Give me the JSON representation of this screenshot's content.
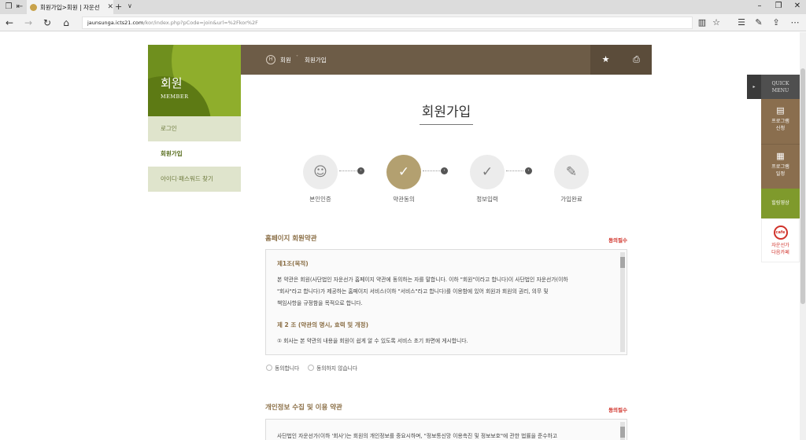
{
  "browser": {
    "tab_title": "회원가입>회원 | 자운선",
    "url_host": "jaunsunga.icts21.com",
    "url_path": "/kor/index.php?pCode=join&url=%2Fkor%2F"
  },
  "lnb": {
    "title": "회원",
    "subtitle": "MEMBER",
    "items": [
      {
        "label": "로그인",
        "active": false
      },
      {
        "label": "회원가입",
        "active": true
      },
      {
        "label": "아이디·패스워드 찾기",
        "active": false
      }
    ]
  },
  "breadcrumb": {
    "home": "H",
    "level1": "회원",
    "level2": "회원가입"
  },
  "page": {
    "title": "회원가입"
  },
  "steps": [
    {
      "label": "본인인증",
      "icon": "person-icon",
      "glyph": "☺",
      "active": false
    },
    {
      "label": "약관동의",
      "icon": "check-circle-icon",
      "glyph": "✓",
      "active": true
    },
    {
      "label": "정보입력",
      "icon": "check-circle-icon",
      "glyph": "✓",
      "active": false
    },
    {
      "label": "가입완료",
      "icon": "pencil-icon",
      "glyph": "✎",
      "active": false
    }
  ],
  "terms": {
    "homepage": {
      "title": "홈페이지 회원약관",
      "required": "동의필수",
      "article1_title": "제1조(목적)",
      "article1_line1": "본 약관은 회원(사단법인 자운선가 홈페이지 약관에 동의하는 자를 말합니다. 이하 \"회원\"이라고 합니다)이 사단법인 자운선가(이하",
      "article1_line2": "\"회사\"라고 합니다)가 제공하는 홈페이지 서비스(이하 \"서비스\"라고 합니다)를 이용함에 있어 회원과 회원의 권리, 의무 및",
      "article1_line3": "책임사항을 규정함을 목적으로 합니다.",
      "article2_title": "제 2 조 (약관의 명시, 효력 및 개정)",
      "article2_line1": "① 회사는 본 약관의 내용을 회원이 쉽게 알 수 있도록 서비스 초기 화면에 게시합니다.",
      "agree_label": "동의합니다",
      "disagree_label": "동의하지 않습니다"
    },
    "privacy": {
      "title": "개인정보 수집 및 이용 약관",
      "required": "동의필수",
      "line1": "사단법인 자운선가(이하 '회사')는 회원의 개인정보를 중요시하며, \"정보통신망 이용촉진 및 정보보호\"에 관한 법률을 준수하고"
    }
  },
  "quick_menu": {
    "title_line1": "QUICK",
    "title_line2": "MENU",
    "items": [
      {
        "line1": "프로그램",
        "line2": "신청",
        "icon": "document-icon"
      },
      {
        "line1": "프로그램",
        "line2": "일정",
        "icon": "calendar-icon"
      },
      {
        "line1": "힐링영상",
        "line2": "",
        "icon": "video-icon"
      },
      {
        "line1": "자운선가",
        "line2": "다음카페",
        "icon": "cafe-icon",
        "badge": "cafe"
      }
    ]
  },
  "colors": {
    "brand_green": "#6f8f1e",
    "brand_brown": "#6d5c47",
    "accent_gold": "#b3a070",
    "required_red": "#d0322a"
  }
}
